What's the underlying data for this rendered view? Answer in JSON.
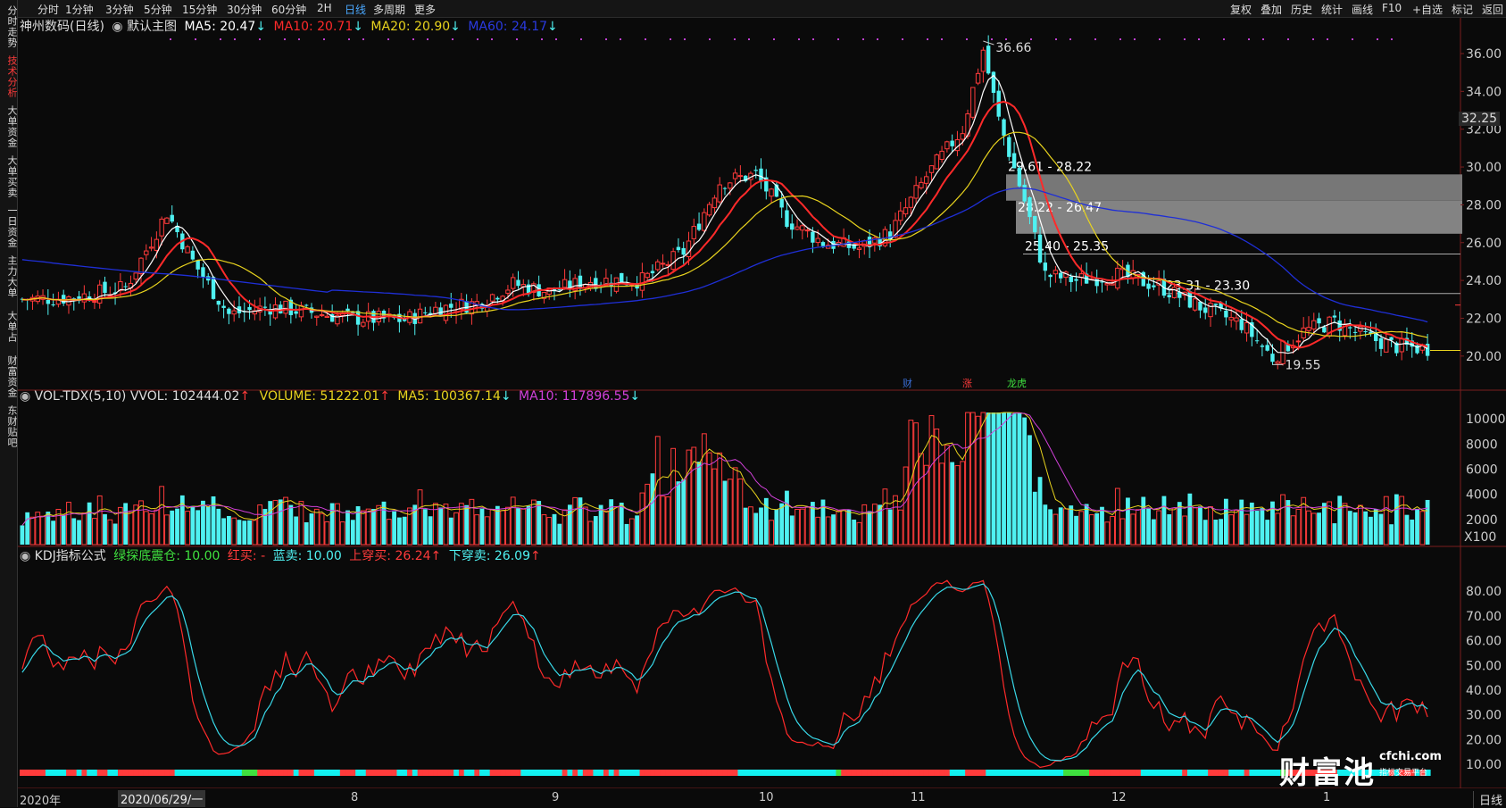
{
  "sidebar": {
    "tabs": [
      "分时走势",
      "技术分析",
      "大单资金",
      "大单买卖",
      "一日资金",
      "主力大单",
      "大单占",
      "财富资金",
      "东财贴吧"
    ],
    "active": 1
  },
  "topbar": {
    "periods": [
      "分时",
      "1分钟",
      "3分钟",
      "5分钟",
      "15分钟",
      "30分钟",
      "60分钟",
      "2H",
      "日线",
      "多周期",
      "更多"
    ],
    "active": "日线",
    "right_items": [
      "复权",
      "叠加",
      "历史",
      "统计",
      "画线",
      "F10",
      "+自选",
      "标记",
      "返回"
    ]
  },
  "main": {
    "stock": "神州数码(日线)",
    "template": "默认主图",
    "ma5": "MA5: 20.47",
    "ma10": "MA10: 20.71",
    "ma20": "MA20: 20.90",
    "ma60": "MA60: 24.17",
    "price_ticks": [
      "36.00",
      "34.00",
      "32.00",
      "30.00",
      "28.00",
      "26.00",
      "24.00",
      "22.00",
      "20.00"
    ],
    "current_price": "32.25",
    "high_label": "36.66",
    "low_label": "19.55",
    "zones": [
      "29.61 - 28.22",
      "28.22 - 26.47",
      "25.40 - 25.35",
      "23.31 - 23.30"
    ],
    "badges": [
      "财",
      "涨",
      "龙虎"
    ]
  },
  "volume": {
    "name": "VOL-TDX(5,10)",
    "vvol": "VVOL: 102444.02",
    "volume": "VOLUME: 51222.01",
    "ma5": "MA5: 100367.14",
    "ma10": "MA10: 117896.55",
    "ticks": [
      "10000",
      "8000",
      "6000",
      "4000",
      "2000"
    ],
    "unit": "X100"
  },
  "kdj": {
    "name": "KDJ指标公式",
    "green": "绿探底震仓: 10.00",
    "red": "红买: -",
    "blue": "蓝卖: 10.00",
    "up": "上穿买: 26.24",
    "down": "下穿卖: 26.09",
    "ticks": [
      "80.00",
      "70.00",
      "60.00",
      "50.00",
      "40.00",
      "30.00",
      "20.00",
      "10.00"
    ]
  },
  "xaxis": {
    "labels": [
      "2020年",
      "2020/06/29/一",
      "8",
      "9",
      "10",
      "11",
      "12",
      "1"
    ],
    "period": "日线"
  },
  "watermark": {
    "big": "财富池",
    "site": "cfchi.com",
    "sub": "指标交易平台"
  },
  "colors": {
    "up": "#ff3b3b",
    "down": "#4ff1f1",
    "ma5": "#ffffff",
    "ma10": "#ff2a2a",
    "ma20": "#e8d31e",
    "ma60": "#1f2fd6",
    "vol_ma5": "#e8d31e",
    "vol_ma10": "#d040d8",
    "kdj_k": "#ff2a2a",
    "kdj_d": "#38d8e8"
  }
}
